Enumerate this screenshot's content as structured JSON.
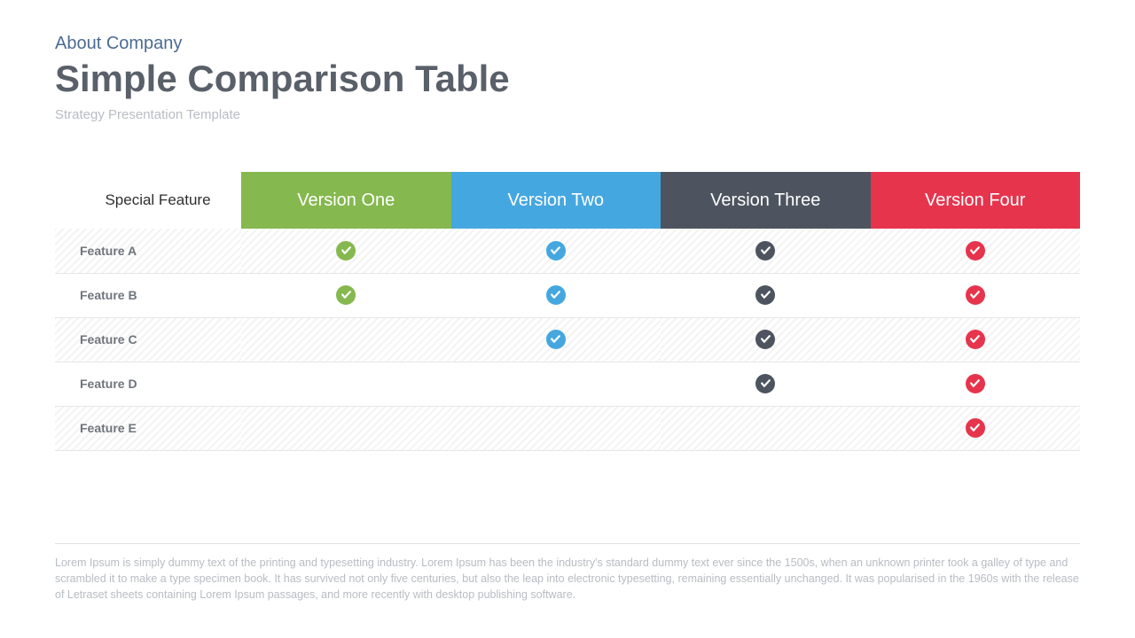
{
  "header": {
    "eyebrow": "About Company",
    "title": "Simple Comparison Table",
    "subtitle": "Strategy Presentation Template"
  },
  "table": {
    "corner_label": "Special Feature",
    "columns": [
      {
        "label": "Version One",
        "color": "#85b84e"
      },
      {
        "label": "Version Two",
        "color": "#45a7e0"
      },
      {
        "label": "Version Three",
        "color": "#4d545f"
      },
      {
        "label": "Version Four",
        "color": "#e7344d"
      }
    ],
    "rows": [
      {
        "label": "Feature A",
        "cells": [
          true,
          true,
          true,
          true
        ]
      },
      {
        "label": "Feature B",
        "cells": [
          true,
          true,
          true,
          true
        ]
      },
      {
        "label": "Feature C",
        "cells": [
          false,
          true,
          true,
          true
        ]
      },
      {
        "label": "Feature D",
        "cells": [
          false,
          false,
          true,
          true
        ]
      },
      {
        "label": "Feature E",
        "cells": [
          false,
          false,
          false,
          true
        ]
      }
    ]
  },
  "footer": {
    "text": "Lorem Ipsum is simply dummy text of the printing and typesetting industry. Lorem Ipsum has been the industry's standard dummy text ever since the 1500s, when an unknown printer took a galley of type and scrambled it to make a type specimen book. It has survived not only five centuries, but also the leap into electronic typesetting, remaining essentially unchanged. It was popularised in the 1960s with the release of Letraset sheets containing Lorem Ipsum passages, and more recently with desktop publishing software."
  }
}
